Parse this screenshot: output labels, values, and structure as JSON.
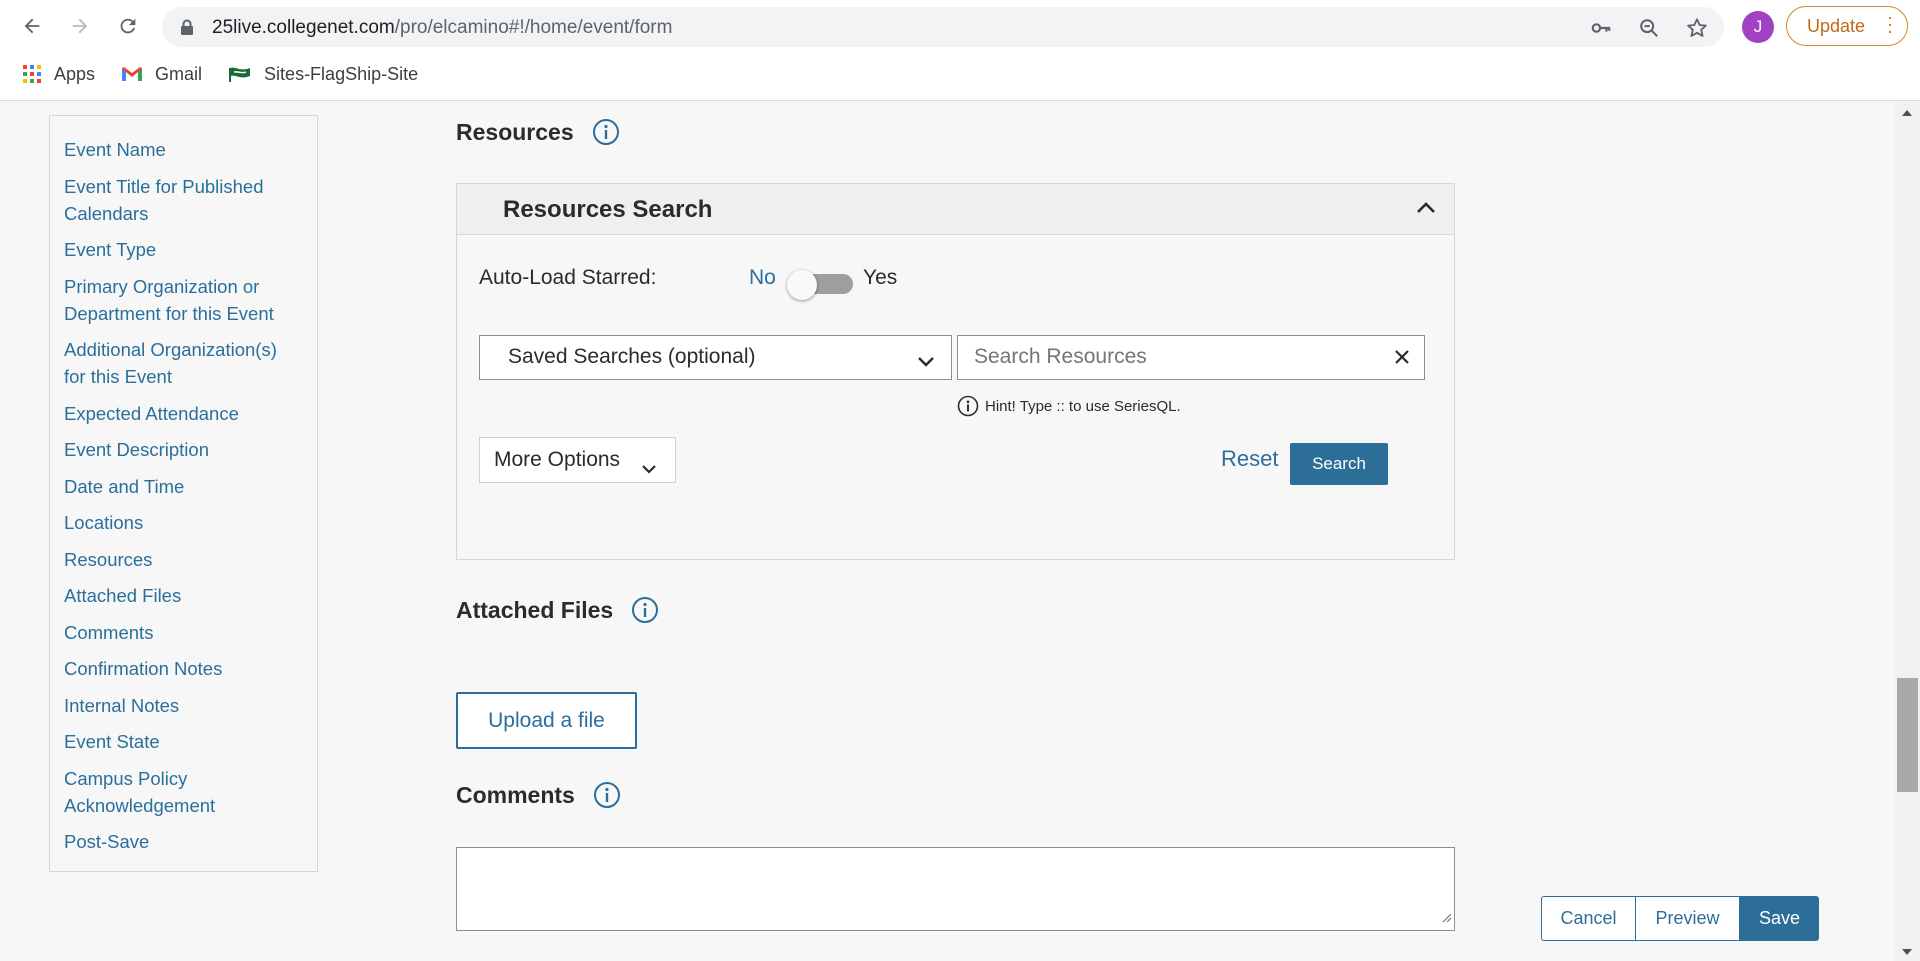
{
  "browser": {
    "url_host": "25live.collegenet.com",
    "url_path": "/pro/elcamino#!/home/event/form",
    "avatar_letter": "J",
    "update_label": "Update",
    "bookmarks": [
      {
        "label": "Apps",
        "icon": "apps-grid-icon"
      },
      {
        "label": "Gmail",
        "icon": "gmail-icon"
      },
      {
        "label": "Sites-FlagShip-Site",
        "icon": "flag-site-icon"
      }
    ]
  },
  "sidebar": {
    "items": [
      {
        "label": "Event Name"
      },
      {
        "label": "Event Title for Published Calendars"
      },
      {
        "label": "Event Type"
      },
      {
        "label": "Primary Organization or Department for this Event"
      },
      {
        "label": "Additional Organization(s) for this Event"
      },
      {
        "label": "Expected Attendance"
      },
      {
        "label": "Event Description"
      },
      {
        "label": "Date and Time"
      },
      {
        "label": "Locations"
      },
      {
        "label": "Resources"
      },
      {
        "label": "Attached Files"
      },
      {
        "label": "Comments"
      },
      {
        "label": "Confirmation Notes"
      },
      {
        "label": "Internal Notes"
      },
      {
        "label": "Event State"
      },
      {
        "label": "Campus Policy Acknowledgement"
      },
      {
        "label": "Post-Save"
      }
    ]
  },
  "resources": {
    "title": "Resources",
    "panel_title": "Resources Search",
    "autoload_label": "Auto-Load Starred:",
    "toggle_no": "No",
    "toggle_yes": "Yes",
    "toggle_state": "No",
    "saved_searches": "Saved Searches (optional)",
    "search_placeholder": "Search Resources",
    "hint": "Hint! Type :: to use SeriesQL.",
    "more_options": "More Options",
    "reset": "Reset",
    "search": "Search"
  },
  "attached_files": {
    "title": "Attached Files",
    "upload": "Upload a file"
  },
  "comments": {
    "title": "Comments",
    "value": ""
  },
  "actions": {
    "cancel": "Cancel",
    "preview": "Preview",
    "save": "Save"
  },
  "colors": {
    "link": "#2a6f9b",
    "primary_button": "#2d6e99",
    "avatar": "#a142c4",
    "update": "#c26a17"
  }
}
